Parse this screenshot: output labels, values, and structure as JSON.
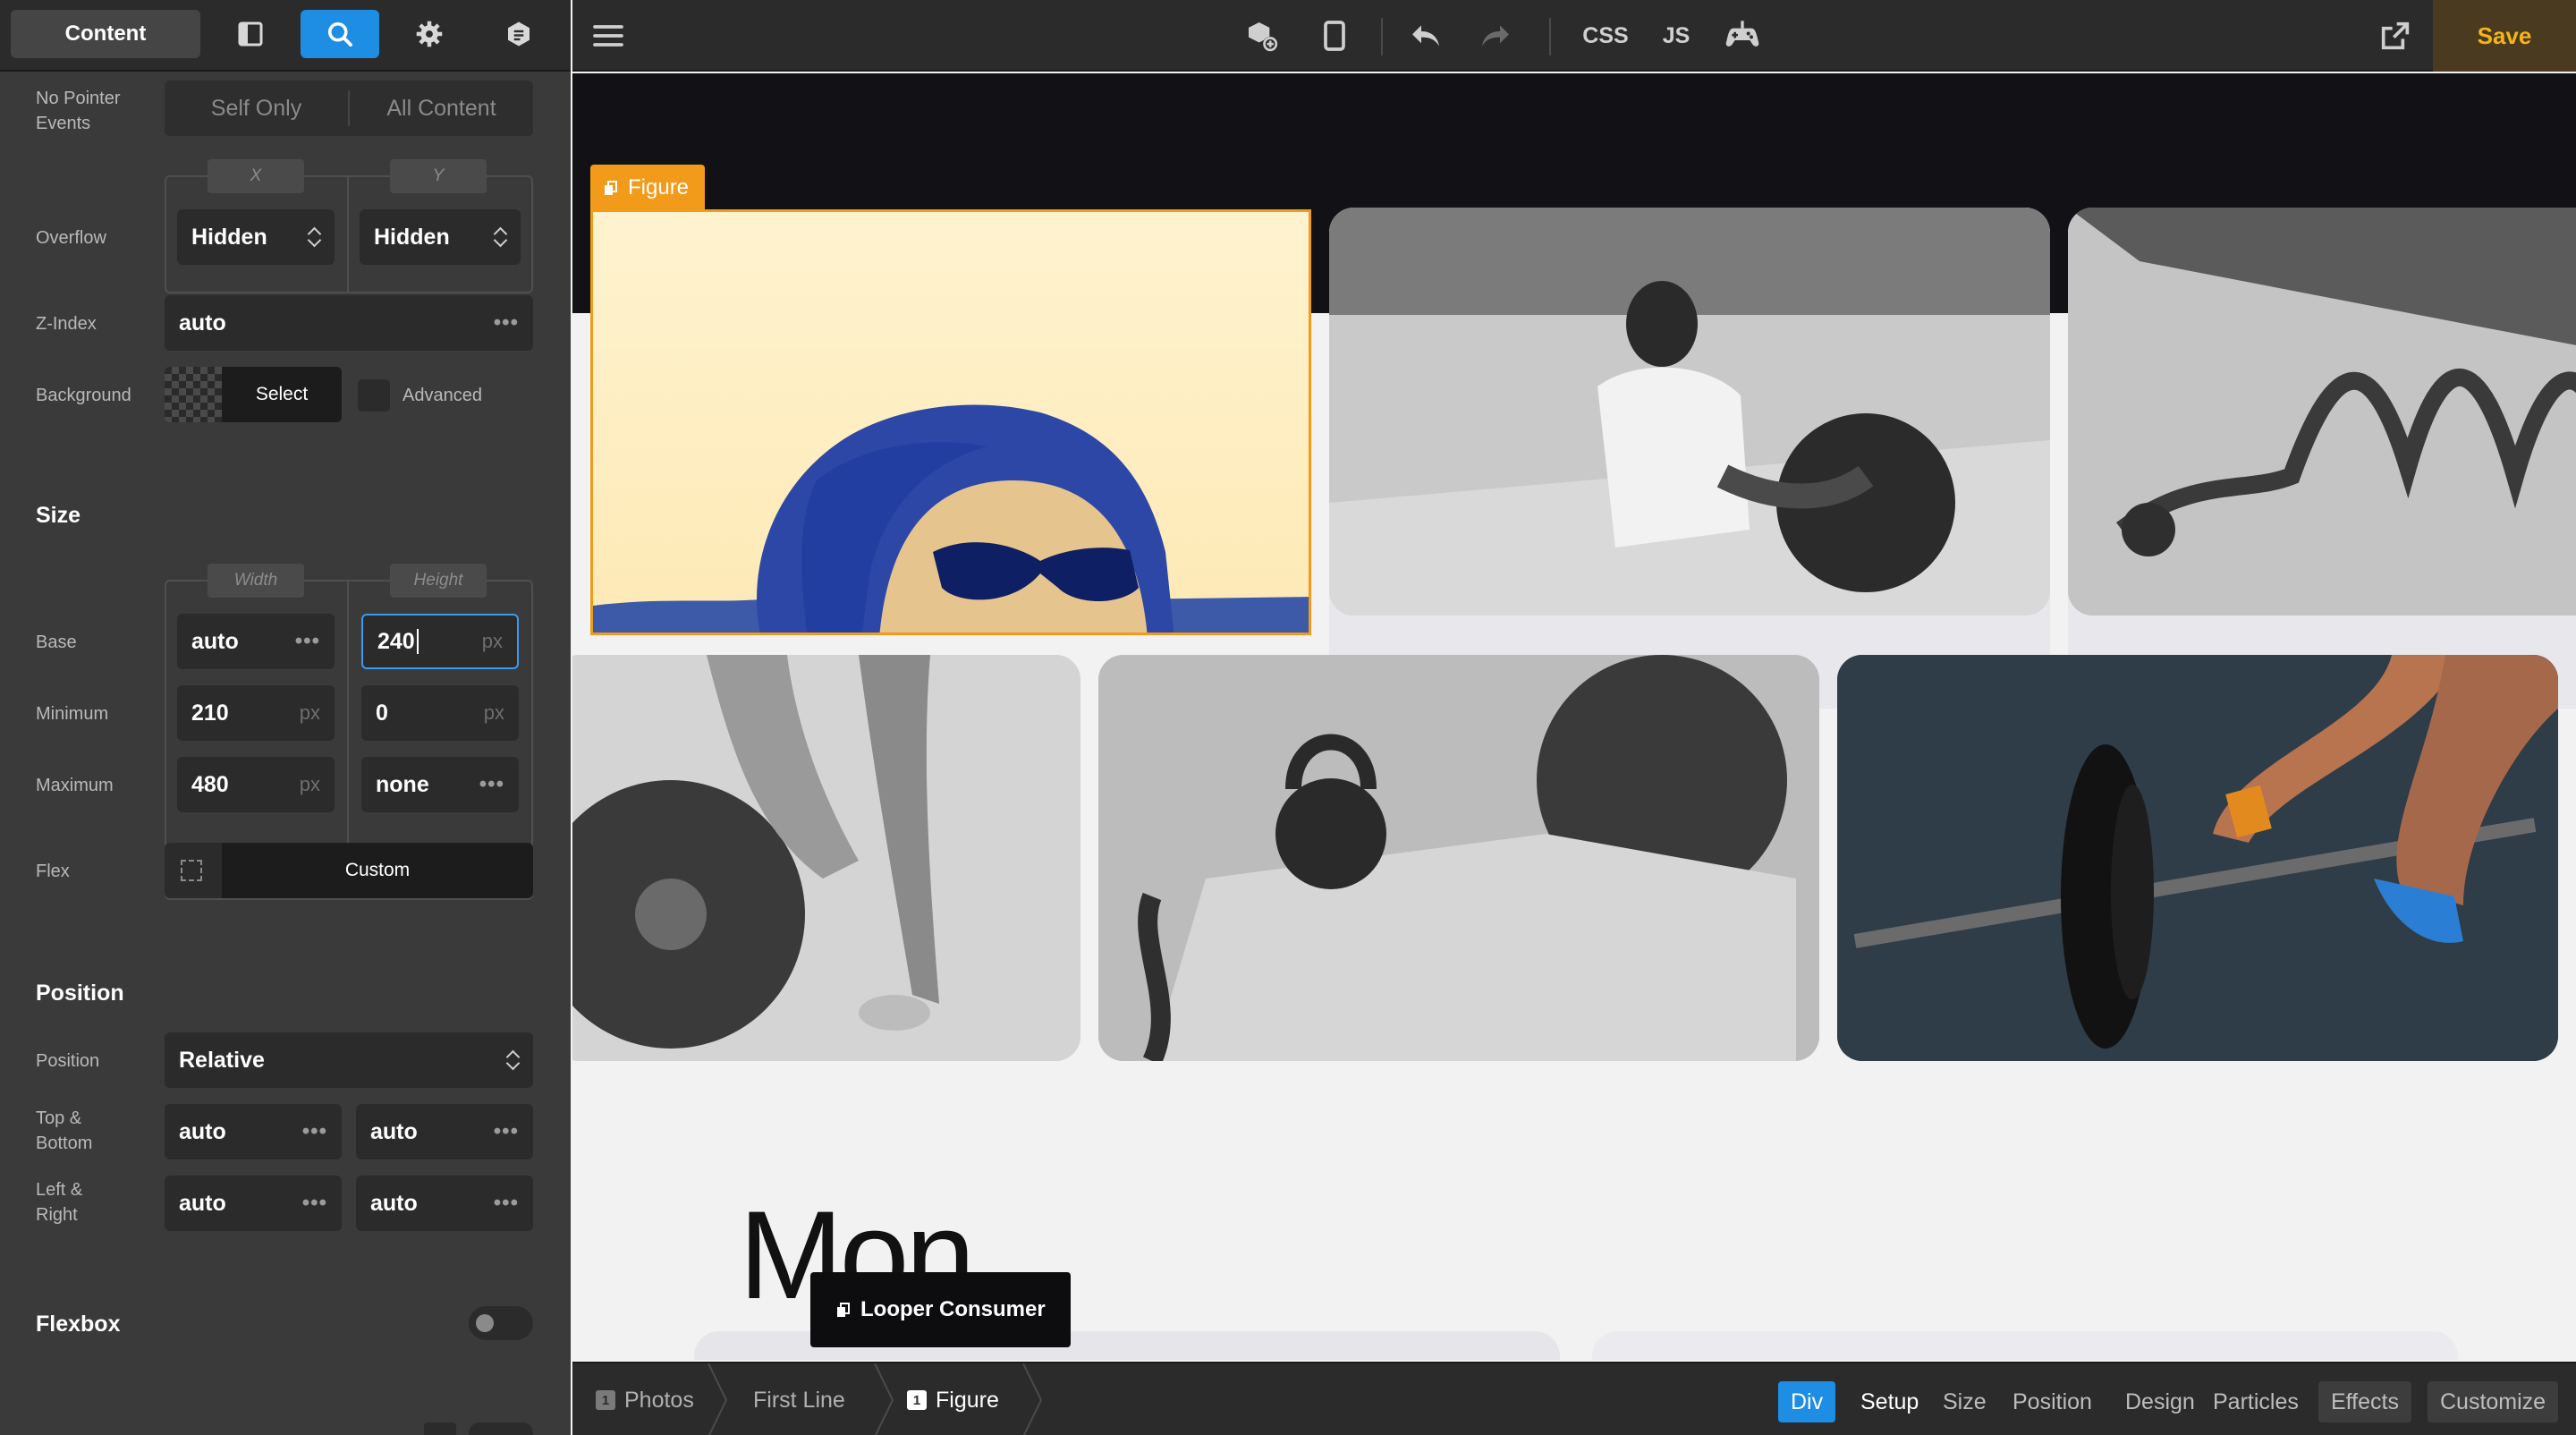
{
  "sidebar": {
    "tabs": {
      "content_label": "Content",
      "layout_icon": "layout-icon",
      "search_icon": "search-icon",
      "settings_icon": "gear-icon",
      "style_icon": "stylebook-icon"
    },
    "pointer_events": {
      "label": "No Pointer\nEvents",
      "options": [
        "Self Only",
        "All Content"
      ]
    },
    "overflow": {
      "label": "Overflow",
      "x_axis": "X",
      "y_axis": "Y",
      "x_value": "Hidden",
      "y_value": "Hidden"
    },
    "z_index": {
      "label": "Z-Index",
      "value": "auto"
    },
    "background": {
      "label": "Background",
      "select_label": "Select",
      "advanced_label": "Advanced"
    },
    "size": {
      "title": "Size",
      "width_label": "Width",
      "height_label": "Height",
      "base": {
        "label": "Base",
        "width": "auto",
        "height": "240",
        "height_unit": "px"
      },
      "minimum": {
        "label": "Minimum",
        "width": "210",
        "width_unit": "px",
        "height": "0",
        "height_unit": "px"
      },
      "maximum": {
        "label": "Maximum",
        "width": "480",
        "width_unit": "px",
        "height": "none"
      },
      "flex": {
        "label": "Flex",
        "value": "Custom"
      }
    },
    "position": {
      "title": "Position",
      "position_label": "Position",
      "position_value": "Relative",
      "top_bottom_label": "Top &\nBottom",
      "top": "auto",
      "bottom": "auto",
      "left_right_label": "Left &\nRight",
      "left": "auto",
      "right": "auto"
    },
    "flexbox": {
      "title": "Flexbox",
      "enabled": false
    }
  },
  "topbar": {
    "css_label": "CSS",
    "js_label": "JS",
    "save_label": "Save"
  },
  "canvas": {
    "figure_tag": "Figure",
    "heading": "Mon",
    "looper_label": "Looper Consumer",
    "colors": {
      "figure_overlay": "#fff1c2",
      "selection": "#f29a1a"
    }
  },
  "bottombar": {
    "breadcrumbs": [
      {
        "num": "1",
        "label": "Photos"
      },
      {
        "label": "First Line"
      },
      {
        "num": "1",
        "label": "Figure"
      }
    ],
    "tabs": [
      "Div",
      "Setup",
      "Size",
      "Position",
      "Design",
      "Particles",
      "Effects",
      "Customize"
    ]
  }
}
